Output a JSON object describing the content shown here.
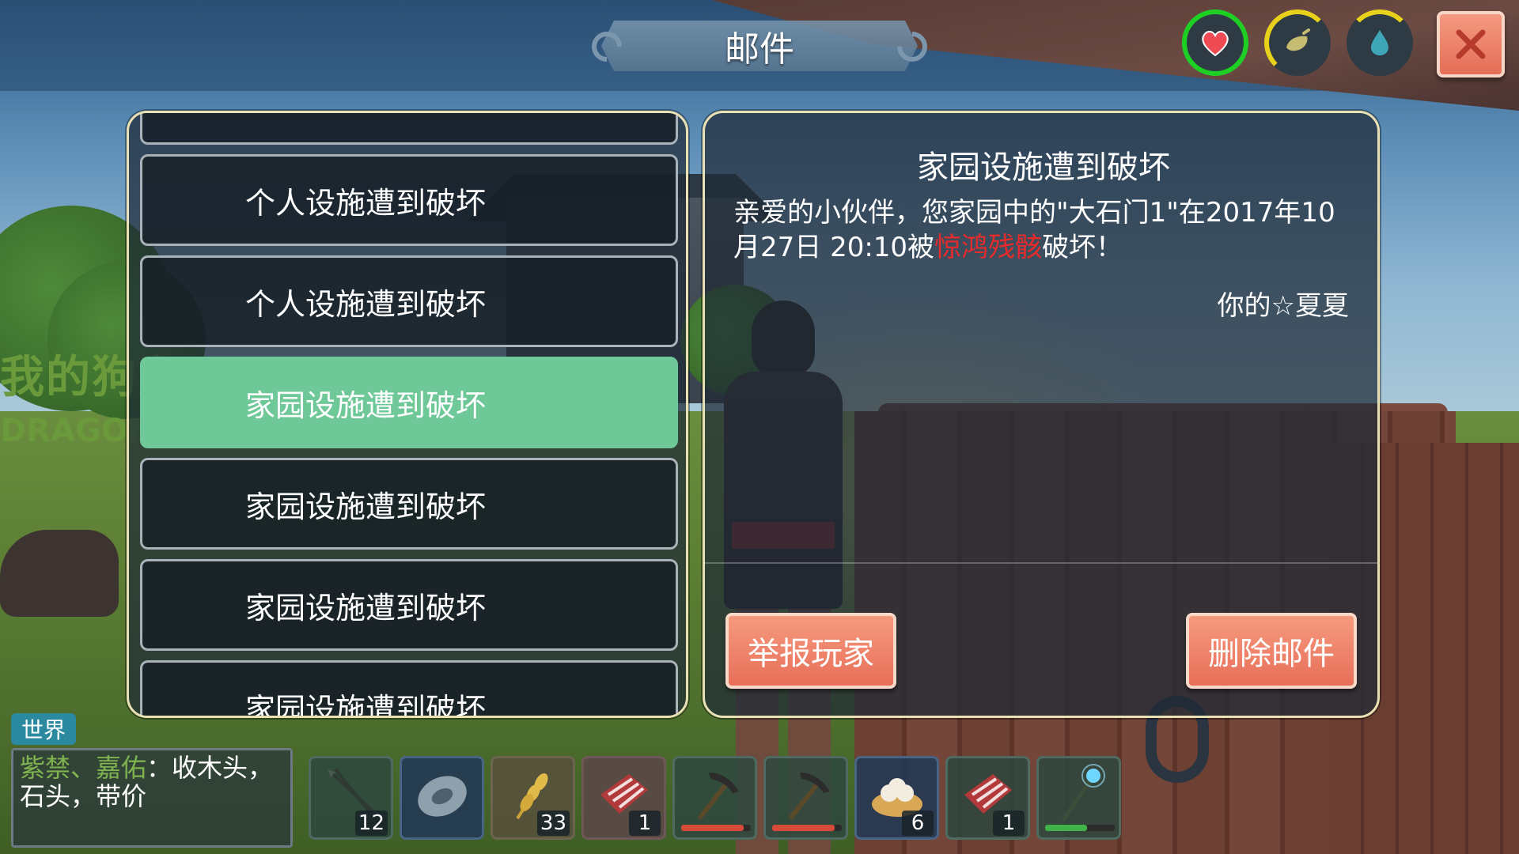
{
  "header": {
    "title": "邮件"
  },
  "status_bar": {
    "health_icon": "heart-icon",
    "hunger_icon": "hunger-icon",
    "thirst_icon": "water-drop-icon",
    "close_icon": "close-icon",
    "colors": {
      "health_ring": "#1fd024",
      "gauge_ring": "#e7d11b",
      "close_bg": "#e56e57"
    }
  },
  "background": {
    "sign_text": "我的狗主",
    "sign_sub": "DRAGON"
  },
  "mail_list": {
    "items": [
      {
        "title": ""
      },
      {
        "title": "个人设施遭到破坏"
      },
      {
        "title": "个人设施遭到破坏"
      },
      {
        "title": "家园设施遭到破坏",
        "selected": true
      },
      {
        "title": "家园设施遭到破坏"
      },
      {
        "title": "家园设施遭到破坏"
      },
      {
        "title": "家园设施遭到破坏"
      }
    ],
    "selected_color": "#6ec898"
  },
  "mail_detail": {
    "title": "家园设施遭到破坏",
    "body_part1": "亲爱的小伙伴，您家园中的\"大石门1\"在2017年10月27日 20:10被",
    "attacker": "惊鸿残骸",
    "body_part2": "破坏！",
    "signature": "你的☆夏夏",
    "report_button": "举报玩家",
    "delete_button": "删除邮件",
    "attacker_color": "#e82a2a"
  },
  "chat": {
    "tab_label": "世界",
    "sender_names": "紫禁、嘉佑",
    "message": "：收木头，石头，带价"
  },
  "hotbar": {
    "slots": [
      {
        "item": "arrows",
        "icon": "arrow-icon",
        "count": "12"
      },
      {
        "item": "stone-disc",
        "icon": "disc-icon",
        "count": ""
      },
      {
        "item": "wheat",
        "icon": "wheat-icon",
        "count": "33"
      },
      {
        "item": "raw-meat",
        "icon": "meat-icon",
        "count": "1"
      },
      {
        "item": "pickaxe",
        "icon": "pickaxe-icon",
        "count": "",
        "durability": 0.9,
        "durability_color": "#d64a3a"
      },
      {
        "item": "pickaxe",
        "icon": "pickaxe-icon",
        "count": "",
        "durability": 0.9,
        "durability_color": "#d64a3a"
      },
      {
        "item": "dumplings",
        "icon": "dumpling-icon",
        "count": "6"
      },
      {
        "item": "raw-meat",
        "icon": "meat-icon",
        "count": "1"
      },
      {
        "item": "magic-staff",
        "icon": "staff-icon",
        "count": "",
        "durability": 0.6,
        "durability_color": "#3fb24a"
      }
    ]
  }
}
